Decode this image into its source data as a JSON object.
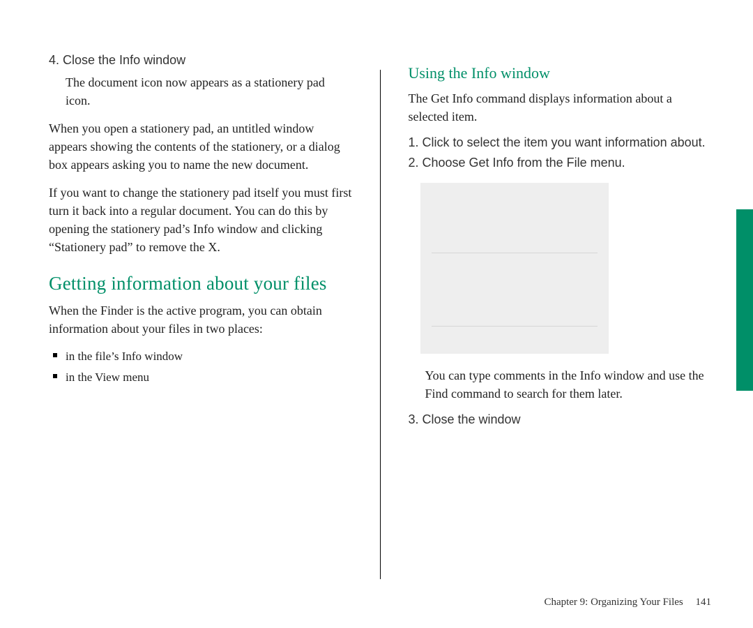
{
  "left": {
    "step4": "4.  Close the Info window",
    "step4_body": "The document icon now appears as a stationery pad icon.",
    "para1": "When you open a stationery pad, an untitled window appears showing the contents of the stationery, or a dialog box appears asking you to name the new document.",
    "para2": "If you want to change the stationery pad itself you must first turn it back into a regular document. You can do this by opening the stationery pad’s Info window and clicking “Stationery pad” to remove the X.",
    "h1": "Getting information about your files",
    "para3": "When the Finder is the active program, you can obtain information about your files in two places:",
    "bullets": {
      "b1": "in the file’s Info window",
      "b2": "in the View menu"
    }
  },
  "right": {
    "h2": "Using the Info window",
    "intro": "The Get Info command displays information about a selected item.",
    "step1": "1.  Click to select the item you want information about.",
    "step2": "2.  Choose Get Info from the File menu.",
    "after_fig": "You can type comments in the Info window and use the Find command to search for them later.",
    "step3": "3.  Close the window"
  },
  "footer": {
    "chapter": "Chapter 9: Organizing Your Files",
    "page": "141"
  }
}
